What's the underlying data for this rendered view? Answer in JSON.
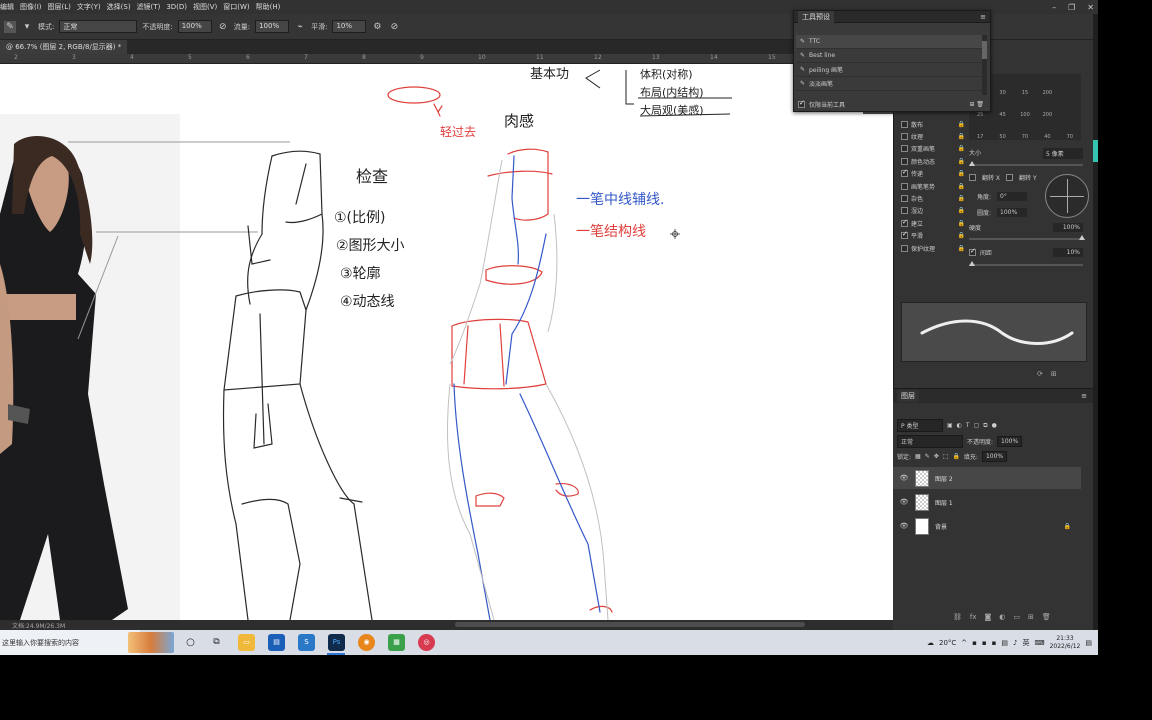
{
  "menu": [
    "编辑",
    "图像(I)",
    "图层(L)",
    "文字(Y)",
    "选择(S)",
    "滤镜(T)",
    "3D(D)",
    "视图(V)",
    "窗口(W)",
    "帮助(H)"
  ],
  "options": {
    "mode_label": "模式:",
    "mode_value": "正常",
    "opacity_label": "不透明度:",
    "opacity_value": "100%",
    "flow_label": "流量:",
    "flow_value": "100%",
    "smoothing_label": "平滑:",
    "smoothing_value": "10%"
  },
  "document_tab": "@ 66.7% (图层 2, RGB/8/显示器) *",
  "ruler_ticks": [
    "2",
    "3",
    "4",
    "5",
    "6",
    "7",
    "8",
    "9",
    "10",
    "11",
    "12",
    "13",
    "14",
    "15",
    "16",
    "17"
  ],
  "status_bar": {
    "doc_size": "文档:24.9M/26.3M"
  },
  "tool_presets": {
    "title": "工具预设",
    "items": [
      "TTC",
      "Best line",
      "peiling 画笔",
      "淡淡画笔"
    ],
    "footer_label": "仅限当前工具"
  },
  "brush": {
    "options": [
      {
        "label": "散布",
        "checked": false
      },
      {
        "label": "纹理",
        "checked": false
      },
      {
        "label": "双重画笔",
        "checked": false
      },
      {
        "label": "颜色动态",
        "checked": false
      },
      {
        "label": "传递",
        "checked": true
      },
      {
        "label": "画笔笔势",
        "checked": false
      },
      {
        "label": "杂色",
        "checked": false
      },
      {
        "label": "湿边",
        "checked": false
      },
      {
        "label": "建立",
        "checked": true
      },
      {
        "label": "平滑",
        "checked": true
      },
      {
        "label": "保护纹理",
        "checked": false
      }
    ],
    "tip_sizes": [
      "25",
      "30",
      "15",
      "200",
      "",
      "25",
      "45",
      "100",
      "200",
      "",
      "17",
      "50",
      "70",
      "40",
      "70"
    ],
    "size_label": "大小",
    "size_value": "5 像素",
    "flip_x": "翻转 X",
    "flip_y": "翻转 Y",
    "angle_label": "角度:",
    "angle_value": "0°",
    "roundness_label": "圆度:",
    "roundness_value": "100%",
    "hardness_label": "硬度",
    "hardness_value": "100%",
    "spacing_label": "间距",
    "spacing_value": "10%"
  },
  "layers": {
    "title": "图层",
    "filter_label": "P 类型",
    "blend_mode": "正常",
    "opacity_label": "不透明度:",
    "opacity_value": "100%",
    "lock_label": "锁定:",
    "fill_label": "填充:",
    "fill_value": "100%",
    "items": [
      {
        "name": "图层 2",
        "selected": true
      },
      {
        "name": "图层 1",
        "selected": false
      },
      {
        "name": "背景",
        "selected": false
      }
    ]
  },
  "sketch_notes": {
    "heading_left": "检查",
    "list": [
      "①(比例)",
      "②图形大小",
      "③轮廓",
      "④动态线"
    ],
    "heading_right": "肉感",
    "note_blue": "一笔中线辅线.",
    "note_red": "一笔结构线",
    "top_note_1": "基本功",
    "top_note_2": "体积(对称)",
    "top_note_3": "布局(内结构)",
    "top_note_4": "大局观(美感)",
    "red_label": "轻过去"
  },
  "taskbar": {
    "search_placeholder": "这里输入你要搜索的内容",
    "temperature": "20°C",
    "ime": "英",
    "time": "21:33",
    "date": "2022/6/12"
  }
}
